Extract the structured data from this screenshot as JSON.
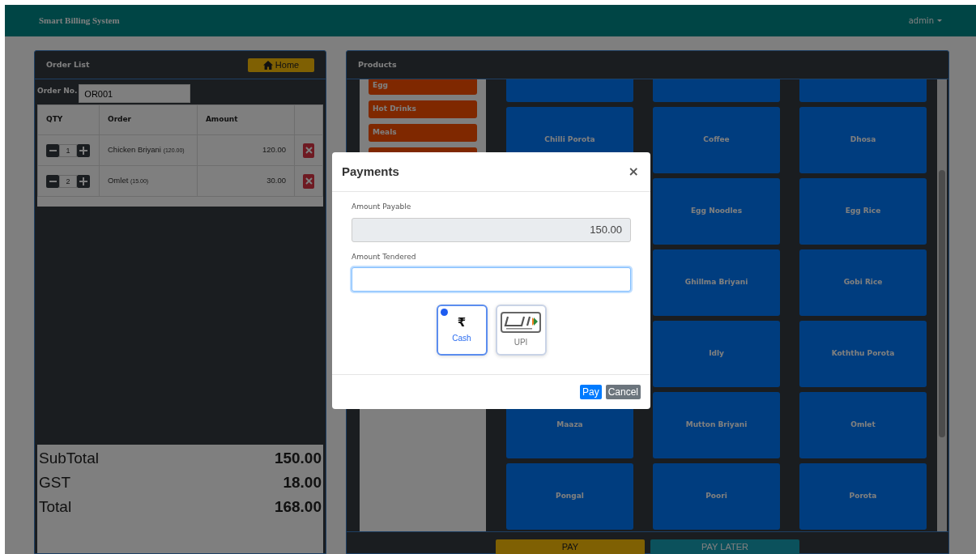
{
  "navbar": {
    "brand": "Smart Billing System",
    "user": "admin"
  },
  "order_panel": {
    "title": "Order List",
    "home_button": "Home",
    "order_no_label": "Order No.",
    "order_no": "OR001",
    "columns": [
      "QTY",
      "Order",
      "Amount"
    ],
    "rows": [
      {
        "qty": "1",
        "item": "Chicken Briyani",
        "price": "(120.00)",
        "amount": "120.00"
      },
      {
        "qty": "2",
        "item": "Omlet",
        "price": "(15.00)",
        "amount": "30.00"
      }
    ],
    "totals": [
      {
        "label": "SubTotal",
        "value": "150.00"
      },
      {
        "label": "GST",
        "value": "18.00"
      },
      {
        "label": "Total",
        "value": "168.00"
      }
    ]
  },
  "products_panel": {
    "title": "Products",
    "categories": [
      {
        "kind": "named",
        "name": "Egg"
      },
      {
        "kind": "named",
        "name": "Hot Drinks"
      },
      {
        "kind": "named",
        "name": "Meals"
      },
      {
        "kind": "blank"
      }
    ],
    "products": [
      [
        {
          "kind": "blank"
        },
        {
          "kind": "blank"
        },
        {
          "kind": "blank"
        }
      ],
      [
        {
          "kind": "named",
          "name": "Chilli Porota"
        },
        {
          "kind": "named",
          "name": "Coffee"
        },
        {
          "kind": "named",
          "name": "Dhosa"
        }
      ],
      [
        {
          "kind": "hidden"
        },
        {
          "kind": "named",
          "name": "Egg Noodles"
        },
        {
          "kind": "named",
          "name": "Egg Rice"
        }
      ],
      [
        {
          "kind": "hidden"
        },
        {
          "kind": "named",
          "name": "Ghillma Briyani"
        },
        {
          "kind": "named",
          "name": "Gobi Rice"
        }
      ],
      [
        {
          "kind": "hidden"
        },
        {
          "kind": "named",
          "name": "Idly"
        },
        {
          "kind": "named",
          "name": "Koththu Porota"
        }
      ],
      [
        {
          "kind": "named",
          "name": "Maaza"
        },
        {
          "kind": "named",
          "name": "Mutton Briyani"
        },
        {
          "kind": "named",
          "name": "Omlet"
        }
      ],
      [
        {
          "kind": "named",
          "name": "Pongal"
        },
        {
          "kind": "named",
          "name": "Poori"
        },
        {
          "kind": "named",
          "name": "Porota"
        }
      ]
    ],
    "buttons": [
      {
        "kind": "warning",
        "label": "PAY"
      },
      {
        "kind": "info",
        "label": "PAY LATER"
      }
    ]
  },
  "modal": {
    "title": "Payments",
    "close": "×",
    "fields": [
      {
        "label": "Amount Payable",
        "value": "150.00",
        "readonly": true,
        "focused": false
      },
      {
        "label": "Amount Tendered",
        "readonly": false,
        "focused": true
      }
    ],
    "methods": [
      {
        "kind": "cash",
        "icon": "₹",
        "label": "Cash",
        "selected": true
      },
      {
        "kind": "upi",
        "label": "UPI",
        "selected": false
      }
    ],
    "buttons": [
      {
        "kind": "primary",
        "label": "Pay"
      },
      {
        "kind": "secondary",
        "label": "Cancel"
      }
    ]
  }
}
